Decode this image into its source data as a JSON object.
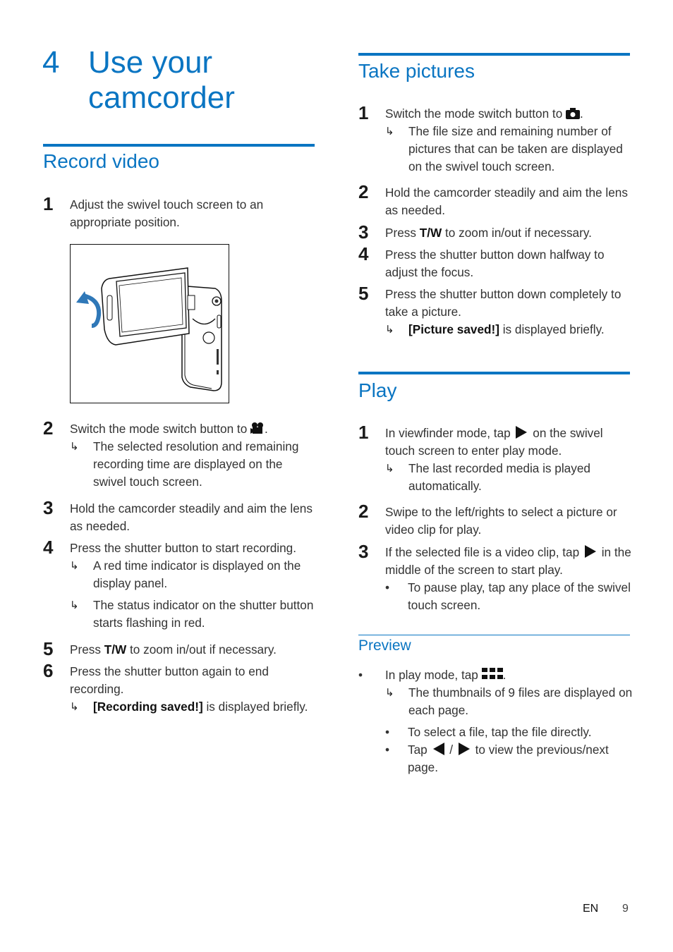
{
  "chapter": {
    "number": "4",
    "title_line1": "Use your",
    "title_line2": "camcorder"
  },
  "record_video": {
    "title": "Record video",
    "steps": [
      {
        "num": "1",
        "text": "Adjust the swivel touch screen to an appropriate position."
      },
      {
        "num": "2",
        "text_before": "Switch the mode switch button to ",
        "icon": "video-camera-icon",
        "text_after": ".",
        "results": [
          "The selected resolution and remaining recording time are displayed on the swivel touch screen."
        ]
      },
      {
        "num": "3",
        "text": "Hold the camcorder steadily and aim the lens as needed."
      },
      {
        "num": "4",
        "text": "Press the shutter button to start recording.",
        "results": [
          "A red time indicator is displayed on the display panel.",
          "The status indicator on the shutter button starts flashing in red."
        ]
      },
      {
        "num": "5",
        "text_before": "Press ",
        "bold": "T/W",
        "text_after": " to zoom in/out if necessary."
      },
      {
        "num": "6",
        "text": "Press the shutter button again to end recording.",
        "results": [
          {
            "bold": "[Recording saved!]",
            "text": " is displayed briefly."
          }
        ]
      }
    ],
    "figure_alt": "Camcorder with swivel touch screen being rotated"
  },
  "take_pictures": {
    "title": "Take pictures",
    "steps": [
      {
        "num": "1",
        "text_before": "Switch the mode switch button to ",
        "icon": "camera-icon",
        "text_after": ".",
        "results": [
          "The file size and remaining number of pictures that can be taken are displayed on the swivel touch screen."
        ]
      },
      {
        "num": "2",
        "text": "Hold the camcorder steadily and aim the lens as needed."
      },
      {
        "num": "3",
        "text_before": "Press ",
        "bold": "T/W",
        "text_after": " to zoom in/out if necessary."
      },
      {
        "num": "4",
        "text": "Press the shutter button down halfway to adjust the focus."
      },
      {
        "num": "5",
        "text": "Press the shutter button down completely to take a picture.",
        "results": [
          {
            "bold": "[Picture saved!]",
            "text": " is displayed briefly."
          }
        ]
      }
    ]
  },
  "play": {
    "title": "Play",
    "steps": [
      {
        "num": "1",
        "text_before": "In viewfinder mode, tap ",
        "icon": "play-icon",
        "text_after": " on the swivel touch screen to enter play mode.",
        "results": [
          "The last recorded media is played automatically."
        ]
      },
      {
        "num": "2",
        "text": "Swipe to the left/rights to select a picture or video clip for play."
      },
      {
        "num": "3",
        "text_before": "If the selected file is a video clip, tap ",
        "icon": "play-icon",
        "text_after": " in the middle of the screen to start play.",
        "bullets": [
          "To pause play, tap any place of the swivel touch screen."
        ]
      }
    ]
  },
  "preview": {
    "title": "Preview",
    "bullet_before": "In play mode, tap ",
    "bullet_icon": "thumbnail-grid-icon",
    "bullet_after": ".",
    "result": "The thumbnails of 9 files are displayed on each page.",
    "sub_bullets": [
      "To select a file, tap the file directly.",
      {
        "text_before": "Tap ",
        "icon1": "previous-icon",
        "sep": " / ",
        "icon2": "next-icon",
        "text_after": " to view the previous/next page."
      }
    ]
  },
  "footer": {
    "language": "EN",
    "page": "9"
  },
  "colors": {
    "accent": "#0a75c2",
    "text": "#333333"
  }
}
